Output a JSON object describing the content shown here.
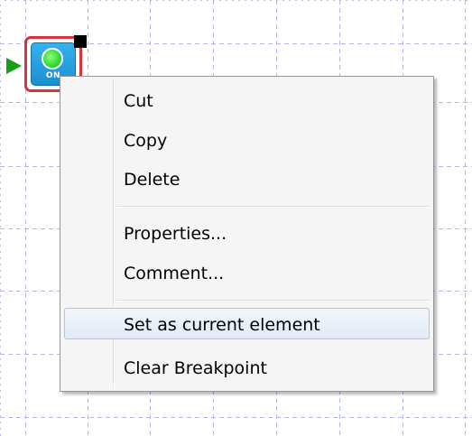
{
  "context_menu": {
    "items": [
      {
        "label": "Cut"
      },
      {
        "label": "Copy"
      },
      {
        "label": "Delete"
      },
      {
        "label": "Properties..."
      },
      {
        "label": "Comment..."
      },
      {
        "label": "Set as current element",
        "highlighted": true
      },
      {
        "label": "Clear Breakpoint"
      }
    ]
  },
  "element": {
    "label": "ON",
    "icon": "green-lamp-icon",
    "frame_color": "#d9323d",
    "tile_color": "#1a8fd0",
    "lamp_color": "#22d12a"
  },
  "colors": {
    "grid": "#b3b8e6",
    "menu_background": "#f5f5f5",
    "highlight_border": "#a8c7ec"
  }
}
